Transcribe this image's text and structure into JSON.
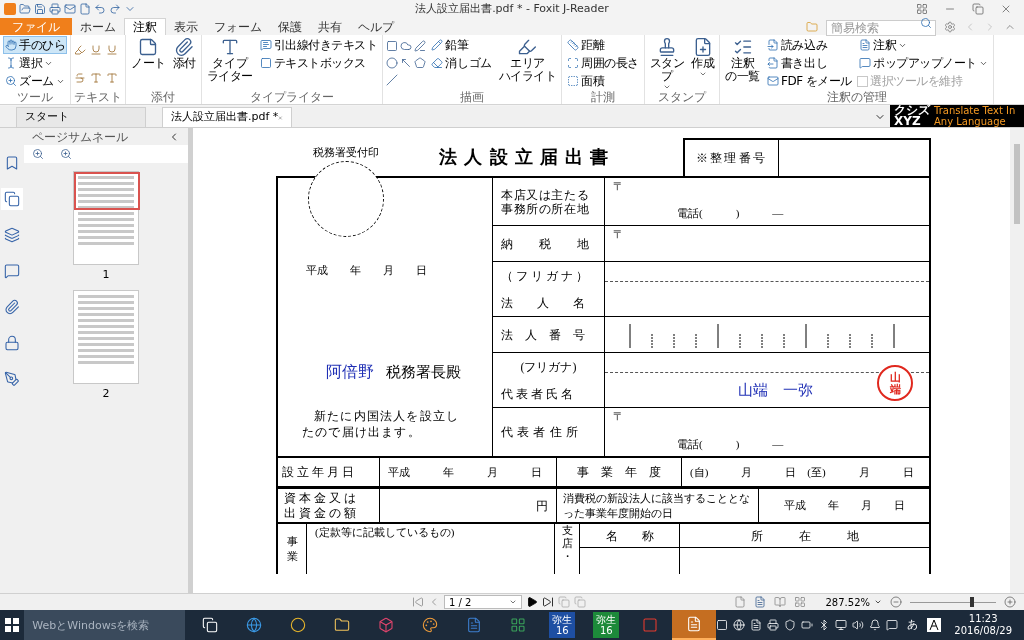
{
  "window": {
    "title": "法人設立届出書.pdf * - Foxit J-Reader"
  },
  "menu_tabs": [
    {
      "label": "ファイル",
      "kind": "file",
      "selected": false
    },
    {
      "label": "ホーム",
      "kind": "tab",
      "selected": false
    },
    {
      "label": "注釈",
      "kind": "tab",
      "selected": true
    },
    {
      "label": "表示",
      "kind": "tab",
      "selected": false
    },
    {
      "label": "フォーム",
      "kind": "tab",
      "selected": false
    },
    {
      "label": "保護",
      "kind": "tab",
      "selected": false
    },
    {
      "label": "共有",
      "kind": "tab",
      "selected": false
    },
    {
      "label": "ヘルプ",
      "kind": "tab",
      "selected": false
    }
  ],
  "search": {
    "placeholder": "簡易検索"
  },
  "ribbon_groups": [
    {
      "label": "ツール",
      "columns": [
        [
          {
            "kind": "small",
            "label": "手のひら",
            "selected": true,
            "dropdown": false
          },
          {
            "kind": "small",
            "label": "選択",
            "selected": false,
            "dropdown": true
          },
          {
            "kind": "small",
            "label": "ズーム",
            "selected": false,
            "dropdown": true
          }
        ]
      ]
    },
    {
      "label": "テキスト",
      "columns": [
        [
          {
            "kind": "text-tools"
          }
        ]
      ]
    },
    {
      "label": "添付",
      "columns": [
        [
          {
            "kind": "large",
            "lines": [
              "ノート"
            ],
            "selected": false,
            "dropdown": false
          }
        ],
        [
          {
            "kind": "large",
            "lines": [
              "添付"
            ],
            "selected": false,
            "dropdown": false
          }
        ]
      ]
    },
    {
      "label": "タイプライター",
      "columns": [
        [
          {
            "kind": "large",
            "lines": [
              "タイプ",
              "ライター"
            ],
            "selected": false,
            "dropdown": false
          }
        ],
        [
          {
            "kind": "small",
            "label": "引出線付きテキスト",
            "selected": false,
            "dropdown": false
          },
          {
            "kind": "small",
            "label": "テキストボックス",
            "selected": false,
            "dropdown": false
          }
        ]
      ]
    },
    {
      "label": "描画",
      "columns": [
        [
          {
            "kind": "shape-tools"
          }
        ],
        [
          {
            "kind": "small",
            "label": "鉛筆",
            "selected": false,
            "dropdown": false
          },
          {
            "kind": "small",
            "label": "消しゴム",
            "selected": false,
            "dropdown": false
          }
        ],
        [
          {
            "kind": "large",
            "lines": [
              "エリア",
              "ハイライト"
            ],
            "selected": false,
            "dropdown": false
          }
        ]
      ]
    },
    {
      "label": "計測",
      "columns": [
        [
          {
            "kind": "small",
            "label": "距離",
            "selected": false,
            "dropdown": false
          },
          {
            "kind": "small",
            "label": "周囲の長さ",
            "selected": false,
            "dropdown": false
          },
          {
            "kind": "small",
            "label": "面積",
            "selected": false,
            "dropdown": false
          }
        ]
      ]
    },
    {
      "label": "スタンプ",
      "columns": [
        [
          {
            "kind": "large",
            "lines": [
              "スタン",
              "プ"
            ],
            "selected": false,
            "dropdown": true
          }
        ],
        [
          {
            "kind": "large",
            "lines": [
              "作成"
            ],
            "selected": false,
            "dropdown": true
          }
        ]
      ]
    },
    {
      "label": "注釈の管理",
      "columns": [
        [
          {
            "kind": "large",
            "lines": [
              "注釈",
              "の一覧"
            ],
            "selected": false,
            "dropdown": false
          }
        ],
        [
          {
            "kind": "small",
            "label": "読み込み",
            "selected": false,
            "dropdown": false
          },
          {
            "kind": "small",
            "label": "書き出し",
            "selected": false,
            "dropdown": false
          },
          {
            "kind": "small",
            "label": "FDF をメール",
            "selected": false,
            "dropdown": false
          }
        ],
        [
          {
            "kind": "small",
            "label": "注釈",
            "selected": false,
            "dropdown": true
          },
          {
            "kind": "small",
            "label": "ポップアップノート",
            "selected": false,
            "dropdown": true
          },
          {
            "kind": "checkbox",
            "label": "選択ツールを維持",
            "checked": false,
            "disabled": true
          }
        ]
      ]
    }
  ],
  "doc_tabs": [
    {
      "label": "スタート",
      "selected": false,
      "closable": false
    },
    {
      "label": "法人設立届出書.pdf *",
      "selected": true,
      "closable": true
    }
  ],
  "ad": {
    "logo_top": "クシズ",
    "logo_bottom": "XYZ",
    "text": "Translate Text In Any Language"
  },
  "side_nav": [
    {
      "selected": false
    },
    {
      "selected": true
    },
    {
      "selected": false
    },
    {
      "selected": false
    },
    {
      "selected": false
    },
    {
      "selected": false
    },
    {
      "selected": false
    }
  ],
  "thumbnail_panel": {
    "title": "ページサムネール",
    "pages": [
      {
        "label": "1",
        "selected": true
      },
      {
        "label": "2",
        "selected": false
      }
    ]
  },
  "form": {
    "title": "法人設立届出書",
    "ref_label": "※整理番号",
    "stamp_label": "税務署受付印",
    "date": "平成　　年　　月　　日",
    "office": "阿倍野",
    "office_suffix": "税務署長殿",
    "notice": "新たに内国法人を設立したので届け出ます。",
    "fields": [
      {
        "kind": "address",
        "label": "本店又は主たる事務所の所在地",
        "postal": "〒",
        "phone": "電話(　　　)　　　—"
      },
      {
        "kind": "address",
        "label": "納　　税　　地",
        "postal": "〒"
      },
      {
        "kind": "name",
        "furigana_label": "（ フ リ ガ ナ ）",
        "label": "法　　人　　名"
      },
      {
        "kind": "number",
        "label": "法　人　番　号"
      },
      {
        "kind": "representative",
        "furigana_label": "(フリガナ)",
        "label": "代 表 者 氏 名",
        "value": "山端　一弥",
        "seal": "山端"
      },
      {
        "kind": "address",
        "label": "代 表 者 住 所",
        "postal": "〒",
        "phone": "電話(　　　)　　　—"
      }
    ],
    "established_label": "設 立 年 月 日",
    "established_value": "平成　　　年　　　月　　　日",
    "fiscal_label": "事　業　年　度",
    "fiscal_value": "(自)　　　月　　　日　(至)　　　月　　　日",
    "capital_label": [
      "資 本 金 又 は",
      "出 資 金 の 額"
    ],
    "capital_unit": "円",
    "consumption_label": "消費税の新設法人に該当することとなった事業年度開始の日",
    "consumption_value": "平成　　年　　月　　日",
    "business_label": "事業",
    "business_note": "(定款等に記載しているもの)",
    "branch_label": "支店・",
    "branch_columns": [
      "名　　称",
      "所　　　在　　　地"
    ]
  },
  "status_bar": {
    "page_field": "1 / 2",
    "zoom": "287.52%",
    "zoom_level": {
      "level": 0.72
    }
  },
  "taskbar": {
    "search_placeholder": "WebとWindowsを検索",
    "apps": [
      {
        "kind": "task-view",
        "selected": false
      },
      {
        "kind": "edge",
        "selected": false
      },
      {
        "kind": "chrome",
        "selected": false
      },
      {
        "kind": "folder",
        "selected": false
      },
      {
        "kind": "box",
        "selected": false
      },
      {
        "kind": "paint",
        "selected": false
      },
      {
        "kind": "word",
        "selected": false
      },
      {
        "kind": "excel",
        "selected": false
      },
      {
        "kind": "yayoi-blue",
        "label": "弥生",
        "sub": "16",
        "selected": false
      },
      {
        "kind": "yayoi-green",
        "label": "弥生",
        "sub": "16",
        "selected": false
      },
      {
        "kind": "red-p",
        "selected": false
      },
      {
        "kind": "foxit",
        "selected": true
      }
    ],
    "ime": "あ",
    "time": "11:23",
    "date": "2016/08/29"
  }
}
